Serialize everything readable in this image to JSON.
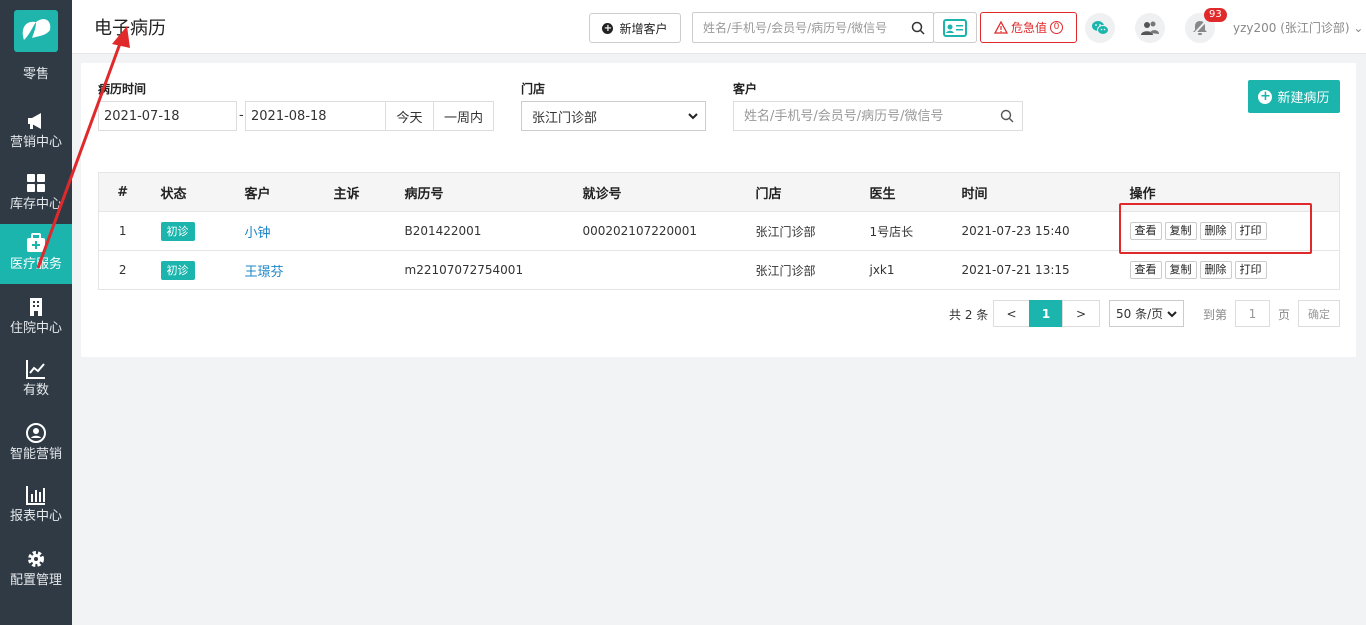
{
  "sidebar": {
    "items": [
      {
        "label": "零售",
        "icon": "retail-icon"
      },
      {
        "label": "营销中心",
        "icon": "megaphone-icon"
      },
      {
        "label": "库存中心",
        "icon": "grid-icon"
      },
      {
        "label": "医疗服务",
        "icon": "medical-kit-icon",
        "active": true
      },
      {
        "label": "住院中心",
        "icon": "hospital-icon"
      },
      {
        "label": "有数",
        "icon": "trend-chart-icon"
      },
      {
        "label": "智能营销",
        "icon": "people-circle-icon"
      },
      {
        "label": "报表中心",
        "icon": "bar-chart-icon"
      },
      {
        "label": "配置管理",
        "icon": "gear-icon"
      }
    ]
  },
  "header": {
    "title": "电子病历",
    "add_customer_label": "新增客户",
    "search_placeholder": "姓名/手机号/会员号/病历号/微信号",
    "danger_label": "危急值",
    "danger_count": "0",
    "notification_count": "93",
    "user_label": "yzy200 (张江门诊部)"
  },
  "filters": {
    "date_label": "病历时间",
    "date_start": "2021-07-18",
    "date_end": "2021-08-18",
    "date_sep": "-",
    "today_label": "今天",
    "week_label": "一周内",
    "store_label": "门店",
    "store_value": "张江门诊部",
    "customer_label": "客户",
    "customer_placeholder": "姓名/手机号/会员号/病历号/微信号",
    "new_record_label": "新建病历"
  },
  "table": {
    "headers": [
      "#",
      "状态",
      "客户",
      "主诉",
      "病历号",
      "就诊号",
      "门店",
      "医生",
      "时间",
      "操作"
    ],
    "rows": [
      {
        "index": "1",
        "status": "初诊",
        "customer": "小钟",
        "complaint": "",
        "record_no": "B201422001",
        "visit_no": "000202107220001",
        "store": "张江门诊部",
        "doctor": "1号店长",
        "time": "2021-07-23 15:40"
      },
      {
        "index": "2",
        "status": "初诊",
        "customer": "王璟芬",
        "complaint": "",
        "record_no": "m22107072754001",
        "visit_no": "",
        "store": "张江门诊部",
        "doctor": "jxk1",
        "time": "2021-07-21 13:15"
      }
    ],
    "actions": {
      "view": "查看",
      "copy": "复制",
      "delete": "删除",
      "print": "打印"
    }
  },
  "pager": {
    "total": "共 2 条",
    "prev": "<",
    "current": "1",
    "next": ">",
    "page_size": "50 条/页",
    "goto_label": "到第",
    "goto_value": "1",
    "page_unit": "页",
    "confirm_label": "确定"
  },
  "colors": {
    "accent": "#1bb5ad",
    "sidebar_bg": "#2f3a45",
    "danger": "#e0292b",
    "link": "#1a84c6"
  }
}
